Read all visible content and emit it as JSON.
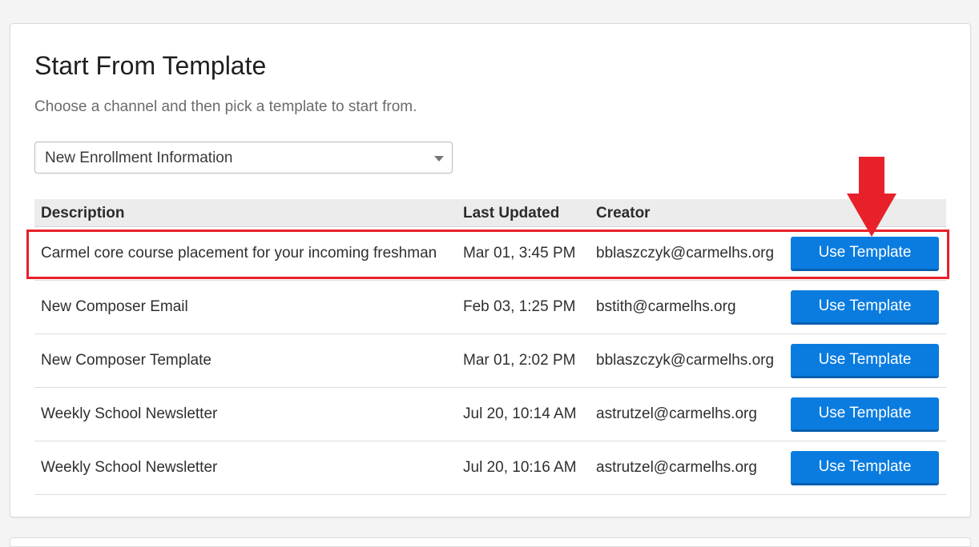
{
  "page": {
    "title": "Start From Template",
    "subtitle": "Choose a channel and then pick a template to start from."
  },
  "channel_select": {
    "selected": "New Enrollment Information"
  },
  "table": {
    "headers": {
      "description": "Description",
      "last_updated": "Last Updated",
      "creator": "Creator"
    },
    "rows": [
      {
        "description": "Carmel core course placement for your incoming freshman",
        "last_updated": "Mar 01, 3:45 PM",
        "creator": "bblaszczyk@carmelhs.org",
        "action": "Use Template"
      },
      {
        "description": "New Composer Email",
        "last_updated": "Feb 03, 1:25 PM",
        "creator": "bstith@carmelhs.org",
        "action": "Use Template"
      },
      {
        "description": "New Composer Template",
        "last_updated": "Mar 01, 2:02 PM",
        "creator": "bblaszczyk@carmelhs.org",
        "action": "Use Template"
      },
      {
        "description": "Weekly School Newsletter",
        "last_updated": "Jul 20, 10:14 AM",
        "creator": "astrutzel@carmelhs.org",
        "action": "Use Template"
      },
      {
        "description": "Weekly School Newsletter",
        "last_updated": "Jul 20, 10:16 AM",
        "creator": "astrutzel@carmelhs.org",
        "action": "Use Template"
      }
    ]
  },
  "colors": {
    "primary_button": "#0a7ce0",
    "annotation_red": "#e8202a"
  },
  "icons": {
    "select_caret": "caret-down-icon",
    "annotation_arrow": "arrow-down-icon"
  }
}
